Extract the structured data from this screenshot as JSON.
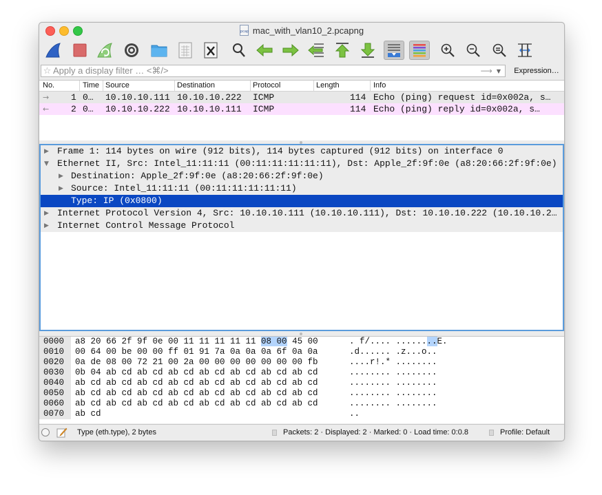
{
  "window": {
    "title": "mac_with_vlan10_2.pcapng",
    "file_icon_text": "pcap"
  },
  "toolbar": {
    "buttons": [
      {
        "name": "start-capture",
        "icon": "shark-fin-icon"
      },
      {
        "name": "stop-capture",
        "icon": "stop-square-icon"
      },
      {
        "name": "restart-capture",
        "icon": "restart-fin-icon"
      },
      {
        "name": "capture-options",
        "icon": "gear-icon"
      },
      {
        "name": "open-file",
        "icon": "folder-icon"
      },
      {
        "name": "save-file",
        "icon": "file-grid-icon"
      },
      {
        "name": "close-file",
        "icon": "close-file-icon"
      },
      {
        "name": "find-packet",
        "icon": "search-icon"
      },
      {
        "name": "go-back",
        "icon": "arrow-left-icon"
      },
      {
        "name": "go-forward",
        "icon": "arrow-right-icon"
      },
      {
        "name": "go-to-packet",
        "icon": "go-to-packet-icon"
      },
      {
        "name": "go-first",
        "icon": "arrow-up-icon"
      },
      {
        "name": "go-last",
        "icon": "arrow-down-icon"
      },
      {
        "name": "auto-scroll",
        "icon": "autoscroll-icon"
      },
      {
        "name": "colorize",
        "icon": "colorize-icon"
      },
      {
        "name": "zoom-in",
        "icon": "zoom-in-icon"
      },
      {
        "name": "zoom-out",
        "icon": "zoom-out-icon"
      },
      {
        "name": "normal-size",
        "icon": "zoom-reset-icon"
      },
      {
        "name": "resize-columns",
        "icon": "resize-columns-icon"
      }
    ]
  },
  "filter": {
    "placeholder": "Apply a display filter … <⌘/>",
    "apply_arrow": "⟶",
    "dropdown_caret": "▼",
    "expression_label": "Expression…"
  },
  "packet_list": {
    "columns": [
      "No.",
      "Time",
      "Source",
      "Destination",
      "Protocol",
      "Length",
      "Info"
    ],
    "rows": [
      {
        "rel": "→",
        "no": "1",
        "time": "0…",
        "source": "10.10.10.111",
        "destination": "10.10.10.222",
        "protocol": "ICMP",
        "length": "114",
        "info": "Echo (ping) request  id=0x002a, s…"
      },
      {
        "rel": "←",
        "no": "2",
        "time": "0…",
        "source": "10.10.10.222",
        "destination": "10.10.10.111",
        "protocol": "ICMP",
        "length": "114",
        "info": "Echo (ping) reply    id=0x002a, s…"
      }
    ]
  },
  "details": {
    "rows": [
      {
        "expander": "▶",
        "text": "Frame 1: 114 bytes on wire (912 bits), 114 bytes captured (912 bits) on interface 0"
      },
      {
        "expander": "▼",
        "text": "Ethernet II, Src: Intel_11:11:11 (00:11:11:11:11:11), Dst: Apple_2f:9f:0e (a8:20:66:2f:9f:0e)"
      },
      {
        "expander": "▶",
        "text": "Destination: Apple_2f:9f:0e (a8:20:66:2f:9f:0e)"
      },
      {
        "expander": "▶",
        "text": "Source: Intel_11:11:11 (00:11:11:11:11:11)"
      },
      {
        "expander": "",
        "text": "Type: IP (0x0800)"
      },
      {
        "expander": "▶",
        "text": "Internet Protocol Version 4, Src: 10.10.10.111 (10.10.10.111), Dst: 10.10.10.222 (10.10.10.2…"
      },
      {
        "expander": "▶",
        "text": "Internet Control Message Protocol"
      }
    ]
  },
  "bytes": {
    "rows": [
      {
        "offset": "0000",
        "hex_a": "a8 20 66 2f 9f 0e 00 11  11 11 11 11 ",
        "hex_hl": "08 00",
        "hex_b": " 45 00",
        "ascii_a": ". f/.... ......",
        "ascii_hl": "..",
        "ascii_b": "E."
      },
      {
        "offset": "0010",
        "hex_a": "00 64 00 be 00 00 ff 01  91 7a 0a 0a 0a 6f 0a 0a",
        "ascii_a": ".d...... .z...o.."
      },
      {
        "offset": "0020",
        "hex_a": "0a de 08 00 72 21 00 2a  00 00 00 00 00 00 00 fb",
        "ascii_a": "....r!.* ........"
      },
      {
        "offset": "0030",
        "hex_a": "0b 04 ab cd ab cd ab cd  ab cd ab cd ab cd ab cd",
        "ascii_a": "........ ........"
      },
      {
        "offset": "0040",
        "hex_a": "ab cd ab cd ab cd ab cd  ab cd ab cd ab cd ab cd",
        "ascii_a": "........ ........"
      },
      {
        "offset": "0050",
        "hex_a": "ab cd ab cd ab cd ab cd  ab cd ab cd ab cd ab cd",
        "ascii_a": "........ ........"
      },
      {
        "offset": "0060",
        "hex_a": "ab cd ab cd ab cd ab cd  ab cd ab cd ab cd ab cd",
        "ascii_a": "........ ........"
      },
      {
        "offset": "0070",
        "hex_a": "ab cd",
        "ascii_a": ".."
      }
    ]
  },
  "status": {
    "field_info": "Type (eth.type), 2 bytes",
    "packets_info": "Packets: 2 · Displayed: 2 · Marked: 0 · Load time: 0:0.8",
    "profile": "Profile: Default"
  },
  "colors": {
    "selection_blue": "#0a47c2",
    "request_row": "#e8e8e8",
    "reply_row": "#fce0ff",
    "focus_border": "#5a9bdc",
    "byte_highlight": "#b3d4fc"
  }
}
